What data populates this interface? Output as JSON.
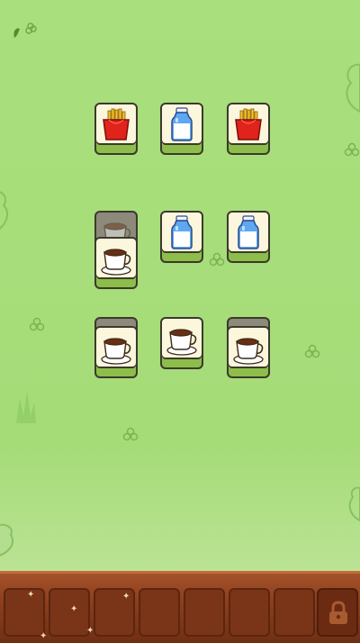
{
  "board": {
    "rows": [
      [
        {
          "item": "fries",
          "state": "open"
        },
        {
          "item": "milk",
          "state": "open"
        },
        {
          "item": "fries",
          "state": "open"
        }
      ],
      [
        {
          "item": "coffee",
          "state": "covered"
        },
        {
          "item": "milk",
          "state": "open"
        },
        {
          "item": "milk",
          "state": "open"
        }
      ],
      [
        {
          "item": "coffee",
          "state": "open"
        },
        {
          "item": "coffee",
          "state": "open"
        },
        {
          "item": "coffee",
          "state": "open"
        }
      ]
    ],
    "stacked_extra": {
      "item": "coffee",
      "state": "open"
    }
  },
  "tray": {
    "slot_count": 7,
    "filled": 0,
    "locked_slot_icon": "lock-icon"
  },
  "colors": {
    "background": "#a9df7c",
    "tile_face": "#fbf6dc",
    "tile_base": "#8dbd4a",
    "tray_wood": "#8c3f1d"
  }
}
